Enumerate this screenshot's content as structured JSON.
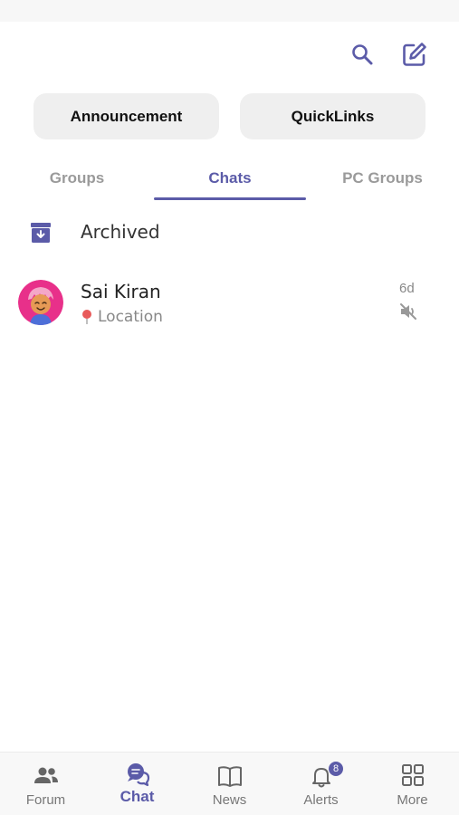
{
  "header": {
    "search_icon": "search-icon",
    "compose_icon": "compose-icon"
  },
  "quick_buttons": {
    "announcement": "Announcement",
    "quicklinks": "QuickLinks"
  },
  "tabs": [
    {
      "label": "Groups",
      "active": false
    },
    {
      "label": "Chats",
      "active": true
    },
    {
      "label": "PC Groups",
      "active": false
    }
  ],
  "archived": {
    "label": "Archived",
    "icon": "archive-icon"
  },
  "chats": [
    {
      "name": "Sai Kiran",
      "subtitle": "Location",
      "time": "6d",
      "muted": true
    }
  ],
  "bottom_nav": {
    "forum": "Forum",
    "chat": "Chat",
    "news": "News",
    "alerts": "Alerts",
    "alerts_badge": "8",
    "more": "More"
  },
  "colors": {
    "accent": "#5b5ba8",
    "muted_text": "#9a9a9a",
    "pill_bg": "#efefef"
  }
}
